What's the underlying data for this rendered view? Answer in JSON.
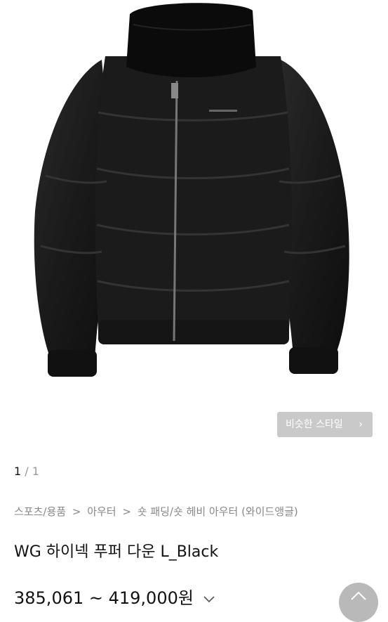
{
  "gallery": {
    "current_page": "1",
    "total_pages": "/ 1",
    "image_icon": "black-puffer-jacket-image"
  },
  "similar_style": {
    "label": "비슷한 스타일",
    "chevron": "›"
  },
  "breadcrumb": {
    "items": [
      "스포츠/용품",
      "아우터",
      "숏 패딩/숏 헤비 아우터 (와이드앵글)"
    ],
    "separator": ">"
  },
  "product": {
    "title": "WG 하이넥 푸퍼 다운 L_Black",
    "price": "385,061 ~ 419,000원"
  },
  "colors": {
    "button_bg": "#c9c9c9",
    "fab_bg": "#b9b9b9",
    "breadcrumb": "#888888"
  }
}
